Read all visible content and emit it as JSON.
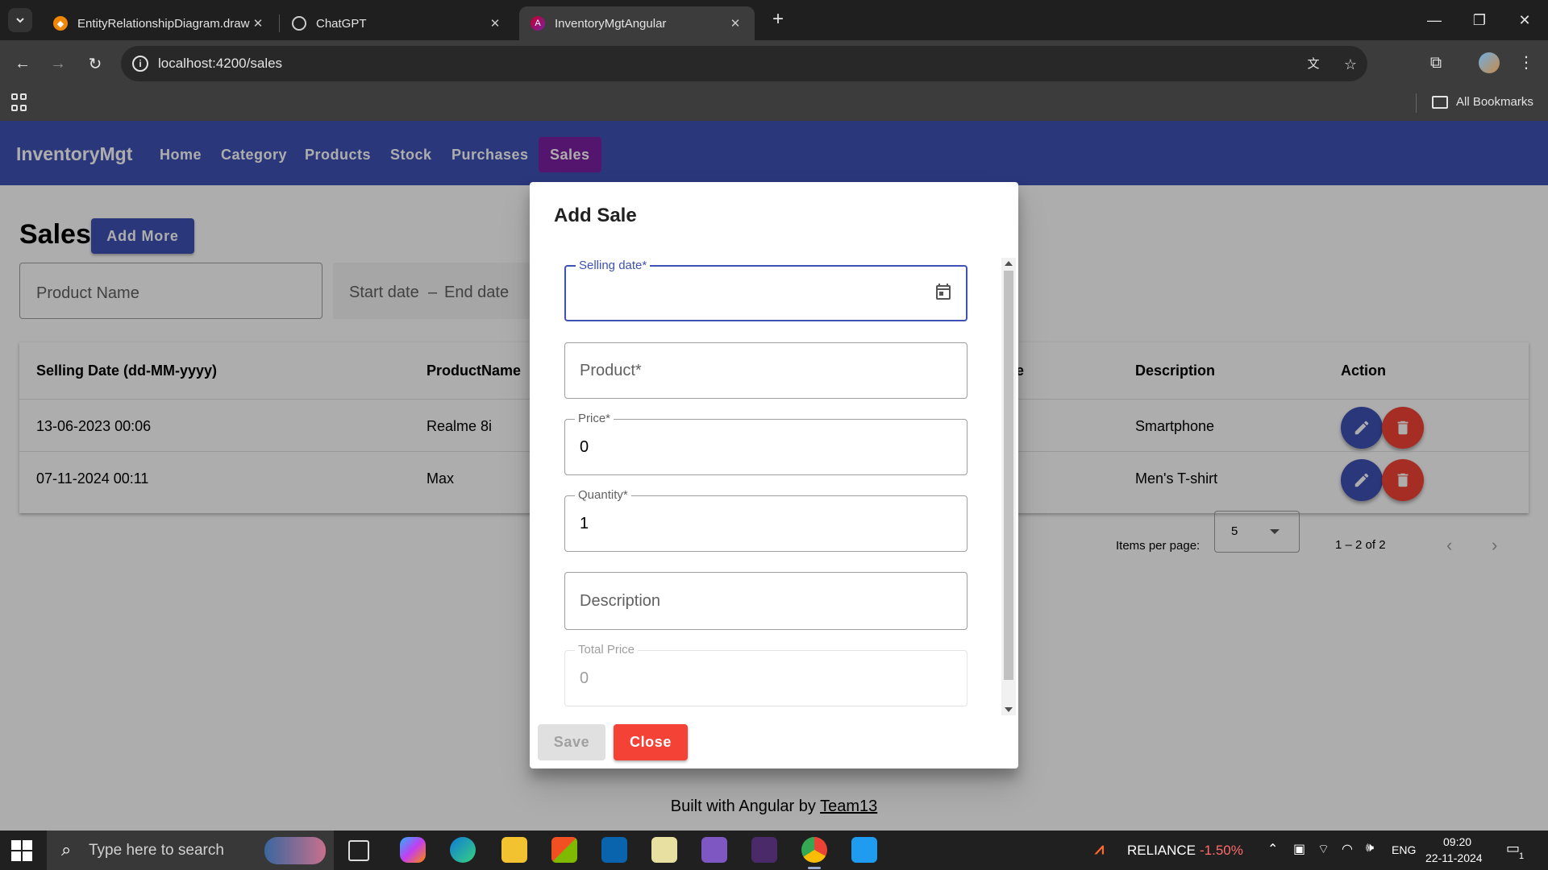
{
  "browser": {
    "tabs": [
      {
        "title": "EntityRelationshipDiagram.draw",
        "favicon_color": "#f08705"
      },
      {
        "title": "ChatGPT",
        "favicon_color": "#444444"
      },
      {
        "title": "InventoryMgtAngular",
        "favicon_color": "#c3002f"
      }
    ],
    "new_tab_icon": "+",
    "url": "localhost:4200/sales",
    "bookmarks_label": "All Bookmarks"
  },
  "app": {
    "brand": "InventoryMgt",
    "nav": [
      "Home",
      "Category",
      "Products",
      "Stock",
      "Purchases",
      "Sales"
    ],
    "active_nav": "Sales",
    "page_title": "Sales",
    "add_more_label": "Add More",
    "filters": {
      "product_placeholder": "Product Name",
      "start_date": "Start date",
      "end_date": "End date",
      "separator": "–"
    },
    "table": {
      "headers": [
        "Selling Date (dd-MM-yyyy)",
        "ProductName",
        "e",
        "Description",
        "Action"
      ],
      "rows": [
        {
          "date": "13-06-2023 00:06",
          "product": "Realme 8i",
          "description": "Smartphone"
        },
        {
          "date": "07-11-2024 00:11",
          "product": "Max",
          "description": "Men's T-shirt"
        }
      ]
    },
    "paginator": {
      "items_per_page_label": "Items per page:",
      "items_per_page_value": "5",
      "range_label": "1 – 2 of 2"
    },
    "footer": {
      "text": "Built with Angular by",
      "link": "Team13"
    }
  },
  "dialog": {
    "title": "Add Sale",
    "fields": {
      "selling_date": {
        "label": "Selling date*",
        "value": ""
      },
      "product": {
        "placeholder": "Product*"
      },
      "price": {
        "label": "Price*",
        "value": "0"
      },
      "quantity": {
        "label": "Quantity*",
        "value": "1"
      },
      "description": {
        "placeholder": "Description"
      },
      "total_price": {
        "label": "Total Price",
        "value": "0"
      }
    },
    "save_label": "Save",
    "close_label": "Close"
  },
  "taskbar": {
    "search_placeholder": "Type here to search",
    "stock_name": "RELIANCE",
    "stock_change": "-1.50%",
    "language": "ENG",
    "time": "09:20",
    "date": "22-11-2024",
    "notification_count": "1"
  },
  "colors": {
    "primary": "#3f51b5",
    "accent": "#7b1fa2",
    "warn": "#f44336"
  }
}
